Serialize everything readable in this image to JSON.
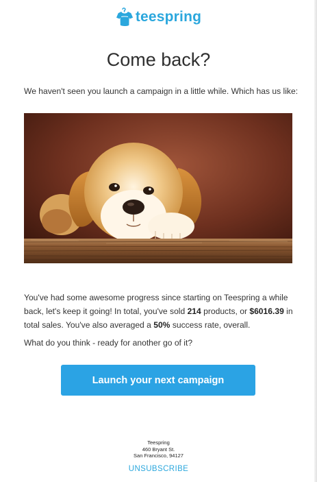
{
  "brand": {
    "name": "teespring",
    "logo_icon": "tshirt-hanger-icon",
    "color": "#2ba7dd"
  },
  "email": {
    "title": "Come back?",
    "intro": "We haven't seen you launch a campaign in a little while. Which has us like:",
    "hero_image": "puppy-photo",
    "progress": {
      "text_1": "You've had some awesome progress since starting on Teespring a while back, let's keep it going! In total, you've sold ",
      "products_sold": "214",
      "text_2": " products, or ",
      "total_sales": "$6016.39",
      "text_3": " in total sales. You've also averaged a ",
      "success_rate": "50%",
      "text_4": " success rate, overall."
    },
    "question": "What do you think - ready for another go of it?",
    "cta_label": "Launch your next campaign",
    "cta_color": "#2ba3e4"
  },
  "footer": {
    "company": "Teespring",
    "street": "460 Bryant St.",
    "city": "San Francisco, 94127",
    "unsubscribe_label": "UNSUBSCRIBE"
  }
}
